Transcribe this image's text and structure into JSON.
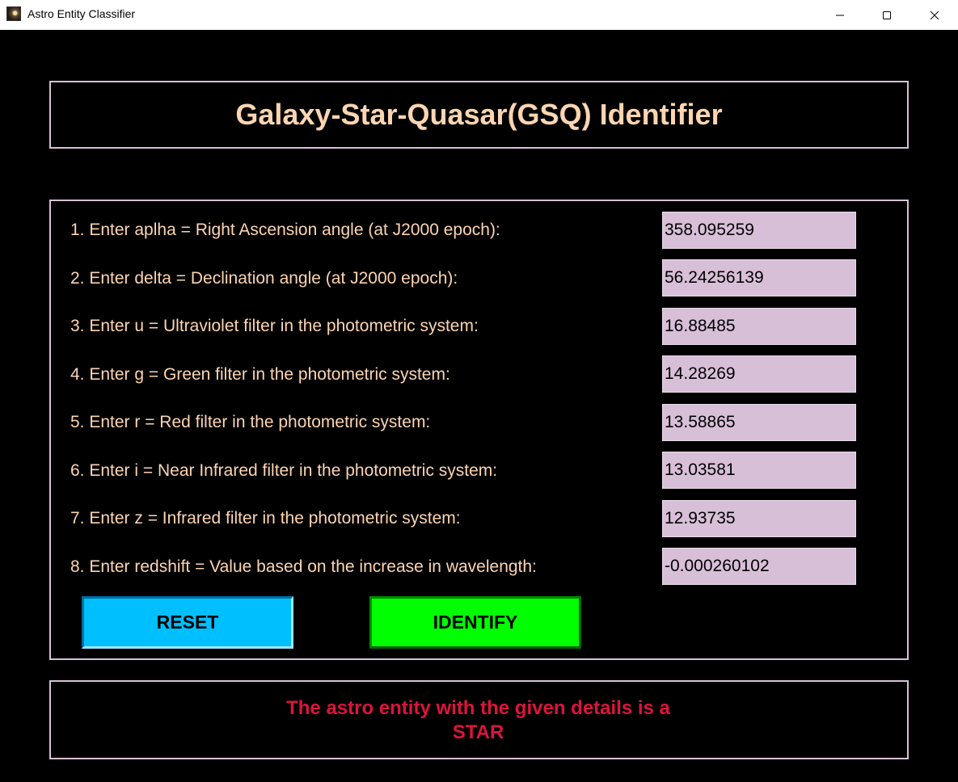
{
  "window": {
    "title": "Astro Entity Classifier",
    "icon": "galaxy-app-icon"
  },
  "header": {
    "title": "Galaxy-Star-Quasar(GSQ) Identifier"
  },
  "form": {
    "fields": [
      {
        "label": "1. Enter aplha = Right Ascension angle (at J2000 epoch):",
        "value": "358.095259"
      },
      {
        "label": "2. Enter delta = Declination angle (at J2000 epoch):",
        "value": "56.24256139"
      },
      {
        "label": "3. Enter u = Ultraviolet filter in the photometric system:",
        "value": "16.88485"
      },
      {
        "label": "4. Enter g = Green filter in the photometric system:",
        "value": "14.28269"
      },
      {
        "label": "5. Enter r = Red filter in the photometric system:",
        "value": "13.58865"
      },
      {
        "label": "6. Enter i = Near Infrared filter in the photometric system:",
        "value": "13.03581"
      },
      {
        "label": "7. Enter z = Infrared filter in the photometric system:",
        "value": "12.93735"
      },
      {
        "label": "8. Enter redshift = Value based on the increase in wavelength:",
        "value": "-0.000260102"
      }
    ],
    "reset_label": "RESET",
    "identify_label": "IDENTIFY"
  },
  "result": {
    "line1": "The astro entity with the given details is a",
    "line2": "STAR"
  },
  "colors": {
    "background": "#000000",
    "label_text": "#fdd5b1",
    "panel_border": "#d8bfd8",
    "input_bg": "#d8bfd8",
    "reset_bg": "#00bfff",
    "identify_bg": "#00ff00",
    "result_text": "#dc143c"
  }
}
